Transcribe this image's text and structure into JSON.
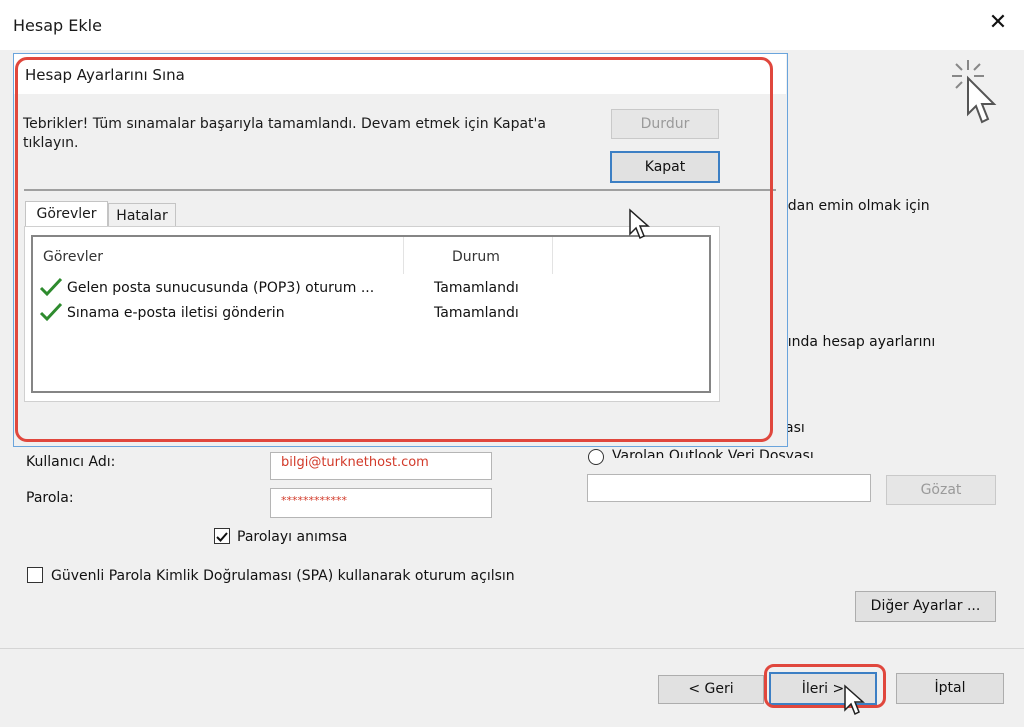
{
  "window": {
    "title": "Hesap Ekle",
    "close_glyph": "✕"
  },
  "background": {
    "partial_text_1": "ından emin olmak için",
    "partial_text_2": "ığında hesap ayarlarını",
    "partial_text_3": "ası",
    "radio_label": "Varolan Outlook Veri Dosyası",
    "browse_button": "Gözat",
    "username_label": "Kullanıcı Adı:",
    "username_value": "bilgi@turknethost.com",
    "password_label": "Parola:",
    "password_value": "************",
    "remember_password_label": "Parolayı anımsa",
    "remember_password_checked": true,
    "spa_label": "Güvenli Parola Kimlik Doğrulaması (SPA) kullanarak oturum açılsın",
    "spa_checked": false,
    "more_settings_button": "Diğer Ayarlar ..."
  },
  "footer": {
    "back_button": "< Geri",
    "next_button": "İleri >",
    "cancel_button": "İptal"
  },
  "test_dialog": {
    "title": "Hesap Ayarlarını Sına",
    "message": "Tebrikler! Tüm sınamalar başarıyla tamamlandı. Devam etmek için Kapat'a tıklayın.",
    "stop_button": "Durdur",
    "close_button": "Kapat",
    "tabs": [
      {
        "label": "Görevler",
        "active": true
      },
      {
        "label": "Hatalar",
        "active": false
      }
    ],
    "columns": [
      "Görevler",
      "Durum"
    ],
    "rows": [
      {
        "task": "Gelen posta sunucusunda (POP3) oturum ...",
        "status": "Tamamlandı",
        "icon": "checkmark-icon"
      },
      {
        "task": "Sınama e-posta iletisi gönderin",
        "status": "Tamamlandı",
        "icon": "checkmark-icon"
      }
    ]
  },
  "colors": {
    "highlight_red": "#e0473d",
    "check_green": "#2e8b2e",
    "dialog_border_blue": "#6aa4dc",
    "username_text": "#d23a2a"
  }
}
